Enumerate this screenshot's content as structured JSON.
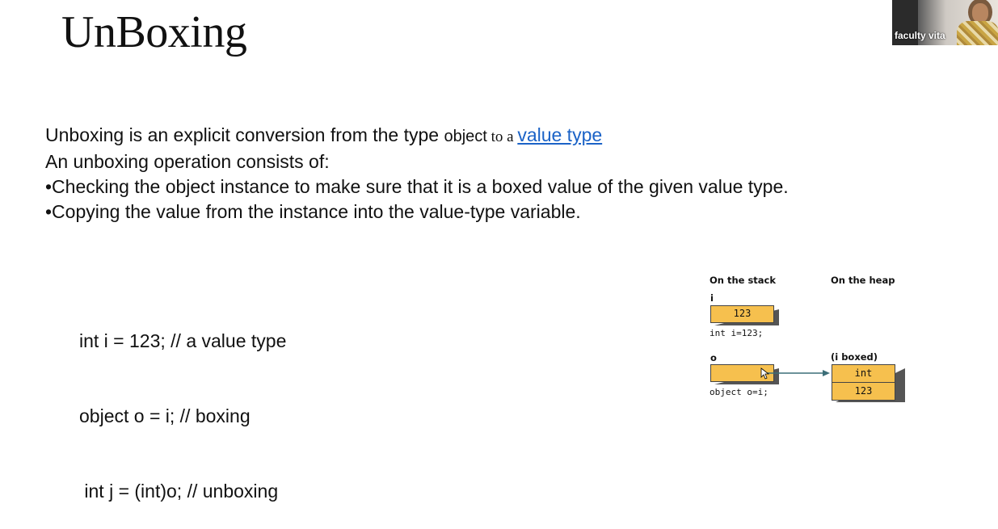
{
  "slide": {
    "title": "UnBoxing",
    "line1_prefix": "Unboxing is an explicit conversion from the type ",
    "line1_object": "object",
    "line1_to_a": " to a ",
    "line1_link": "value type",
    "line2": " An unboxing operation consists of:",
    "line3": "•Checking the object instance to make sure that it is a boxed value of the given value type.",
    "line4": "•Copying the value from the instance into the value-type variable."
  },
  "code": {
    "line1": "int i = 123; // a value type",
    "line2": "object o = i; // boxing",
    "line3": " int j = (int)o; // unboxing"
  },
  "diagram": {
    "stack_header": "On the stack",
    "heap_header": "On the heap",
    "var_i": "i",
    "i_value": "123",
    "i_code": "int i=123;",
    "var_o": "o",
    "o_code": "object o=i;",
    "boxed_label": "(i boxed)",
    "boxed_type": "int",
    "boxed_value": "123",
    "box_color": "#f6c04e"
  },
  "video": {
    "participant_name": "faculty vita"
  }
}
